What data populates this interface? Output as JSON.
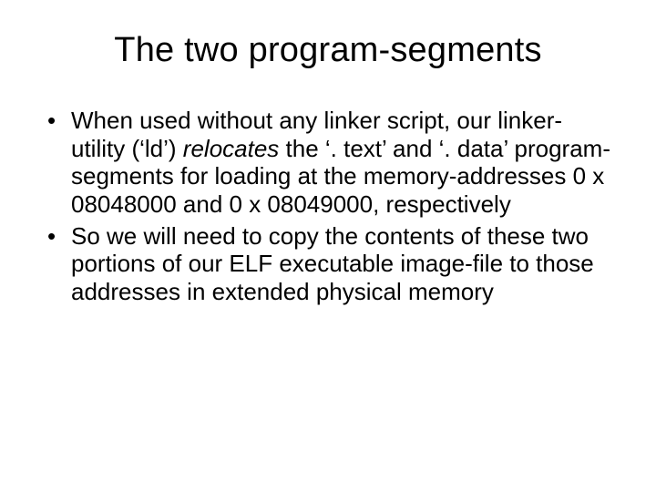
{
  "slide": {
    "title": "The two program-segments",
    "bullets": [
      {
        "pre": "When used without any linker script, our linker-utility (‘ld’) ",
        "em": "relocates",
        "post": " the ‘. text’ and ‘. data’ program-segments for loading at the memory-addresses 0 x 08048000 and 0 x 08049000, respectively"
      },
      {
        "pre": "So we will need to copy the contents of these two portions of our ELF executable image-file to those addresses in extended physical memory",
        "em": "",
        "post": ""
      }
    ]
  }
}
